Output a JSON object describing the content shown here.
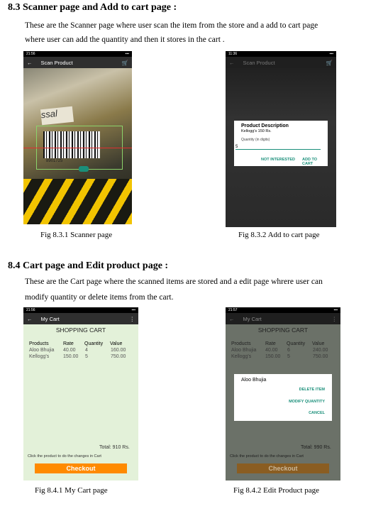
{
  "sec83": {
    "heading": "8.3 Scanner page and Add to cart page :",
    "para1": "These are the Scanner page where user scan the item from the store and a add to cart page",
    "para2": "where user can add the quantity and then it stores in the cart .",
    "fig1": "Fig 8.3.1 Scanner page",
    "fig2": "Fig 8.3.2 Add to cart page"
  },
  "scan": {
    "status": "21:56",
    "title": "Scan Product",
    "barcode": "8901725",
    "pkg1": "BEST BEFORE",
    "pkg2": "ssal"
  },
  "add": {
    "status": "11:36",
    "title": "Scan Product",
    "dialog_title": "Product Description",
    "product": "Kellogg's   150 Rs.",
    "qty_label": "Quantity (in digits)",
    "qty_value": "5",
    "btn_no": "NOT INTERESTED",
    "btn_add": "ADD TO CART"
  },
  "sec84": {
    "heading": "8.4 Cart page and Edit product page :",
    "para1": "These are the Cart page where the scanned items are stored and a edit page whrere user can",
    "para2": "modify quantity or delete items from the cart.",
    "fig1": "Fig 8.4.1 My Cart  page",
    "fig2": "Fig 8.4.2 Edit Product page"
  },
  "cart1": {
    "status": "21:56",
    "title": "My Cart",
    "heading": "SHOPPING CART",
    "h_products": "Products",
    "h_rate": "Rate",
    "h_qty": "Quantity",
    "h_value": "Value",
    "r1": {
      "p": "Aloo Bhujia",
      "r": "40.00",
      "q": "4",
      "v": "160.00"
    },
    "r2": {
      "p": "Kellogg's",
      "r": "150.00",
      "q": "5",
      "v": "750.00"
    },
    "total": "Total: 910 Rs.",
    "hint": "Click the product to do the changes in Cart",
    "checkout": "Checkout"
  },
  "cart2": {
    "status": "21:57",
    "title": "My Cart",
    "heading": "SHOPPING CART",
    "h_products": "Products",
    "h_rate": "Rate",
    "h_qty": "Quantity",
    "h_value": "Value",
    "r1": {
      "p": "Aloo Bhujia",
      "r": "40.00",
      "q": "6",
      "v": "240.00"
    },
    "r2": {
      "p": "Kellogg's",
      "r": "150.00",
      "q": "5",
      "v": "750.00"
    },
    "total": "Total: 990 Rs.",
    "hint": "Click the product to do the changes in Cart",
    "checkout": "Checkout",
    "dialog_title": "Aloo Bhujia",
    "opt1": "DELETE ITEM",
    "opt2": "MODIFY QUANTITY",
    "opt3": "CANCEL"
  },
  "colors": {
    "toolbar": "#2f2f2f",
    "cart_bg": "#e3f1d9",
    "checkout": "#ff8a00",
    "accent": "#1a8f7a"
  }
}
